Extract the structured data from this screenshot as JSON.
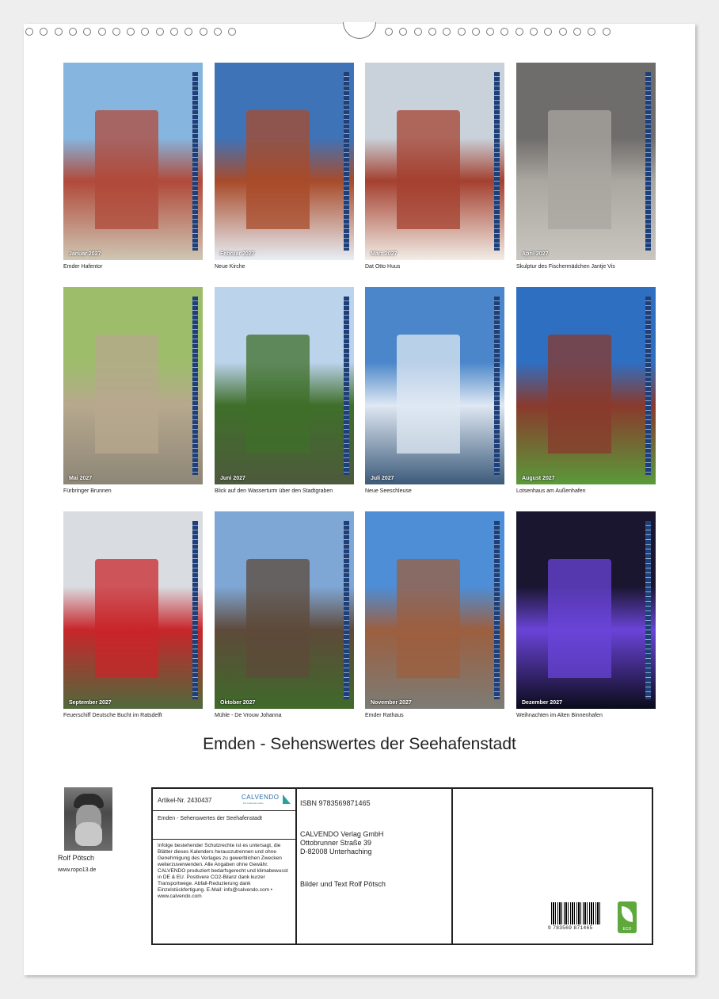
{
  "calendar": {
    "title": "Emden - Sehenswertes der Seehafenstadt",
    "months": [
      {
        "label": "Januar 2027",
        "caption": "Emder Hafentor",
        "icon": "harbor-gate-photo",
        "colors": [
          "#86b6e0",
          "#b04a3a",
          "#cfc6b4"
        ]
      },
      {
        "label": "Februar 2027",
        "caption": "Neue Kirche",
        "icon": "church-tower-photo",
        "colors": [
          "#3f73b8",
          "#a84b2a",
          "#e8eef5"
        ]
      },
      {
        "label": "März 2027",
        "caption": "Dat Otto Huus",
        "icon": "building-photo",
        "colors": [
          "#c9d2da",
          "#a4402f",
          "#f2ede6"
        ]
      },
      {
        "label": "April 2027",
        "caption": "Skulptur des Fischermädchen Jantje Vis",
        "icon": "statue-photo",
        "colors": [
          "#6f6d6b",
          "#aaa6a0",
          "#c9c6c0"
        ]
      },
      {
        "label": "Mai 2027",
        "caption": "Fürbringer Brunnen",
        "icon": "fountain-photo",
        "colors": [
          "#9dbd6a",
          "#b7a88e",
          "#8d8677"
        ]
      },
      {
        "label": "Juni 2027",
        "caption": "Blick auf den Wasserturm über den Stadtgraben",
        "icon": "water-tower-photo",
        "colors": [
          "#bcd3ec",
          "#3f6f2a",
          "#4d5a3c"
        ]
      },
      {
        "label": "Juli 2027",
        "caption": "Neue Seeschleuse",
        "icon": "ship-lock-photo",
        "colors": [
          "#4a86c9",
          "#dfe8f3",
          "#3c5a7a"
        ]
      },
      {
        "label": "August 2027",
        "caption": "Lotsenhaus am Außenhafen",
        "icon": "pilot-house-photo",
        "colors": [
          "#2f6fc2",
          "#8a3a2c",
          "#5a9a3a"
        ]
      },
      {
        "label": "September 2027",
        "caption": "Feuerschiff Deutsche Bucht im Ratsdelft",
        "icon": "lightship-photo",
        "colors": [
          "#d9dde2",
          "#c8252a",
          "#4f6a3c"
        ]
      },
      {
        "label": "Oktober 2027",
        "caption": "Mühle - De Vrouw Johanna",
        "icon": "windmill-photo",
        "colors": [
          "#7fa7d6",
          "#5e4a3a",
          "#3f6a2a"
        ]
      },
      {
        "label": "November 2027",
        "caption": "Emder Rathaus",
        "icon": "town-hall-photo",
        "colors": [
          "#4d8ed6",
          "#9c5f3f",
          "#7c7c76"
        ]
      },
      {
        "label": "Dezember 2027",
        "caption": "Weihnachten im Alten Binnenhafen",
        "icon": "night-harbor-photo",
        "colors": [
          "#1a1630",
          "#6a44d8",
          "#0b0b1a"
        ]
      }
    ]
  },
  "author": {
    "name": "Rolf Pötsch",
    "website": "www.ropo13.de"
  },
  "info": {
    "article_no": "Artikel-Nr. 2430437",
    "logo_text": "CALVENDO",
    "logo_sub": "Die Kalendermarke",
    "calendar_title": "Emden - Sehenswertes der Seehafenstadt",
    "legal": "Infolge bestehender Schutzrechte ist es untersagt, die Blätter dieses Kalenders herauszutrennen und ohne Genehmigung des Verlages zu gewerblichen Zwecken weiterzuverwenden. Alle Angaben ohne Gewähr. CALVENDO produziert bedarfsgerecht und klimabewusst in DE & EU. Positivere CO2-Bilanz dank kurzer Transportwege. Abfall-Reduzierung dank Einzelstückfertigung. E-Mail: info@calvendo.com • www.calvendo.com",
    "isbn": "ISBN 9783569871465",
    "publisher_line1": "CALVENDO Verlag GmbH",
    "publisher_line2": "Ottobrunner Straße 39",
    "publisher_line3": "D-82008 Unterhaching",
    "credit": "Bilder und Text Rolf Pötsch",
    "barcode_number": "9 783569 871465",
    "eco_label": "ECO"
  }
}
